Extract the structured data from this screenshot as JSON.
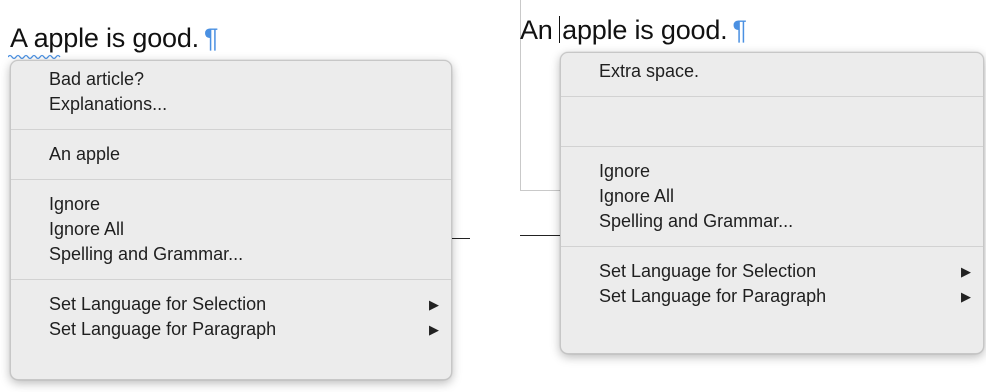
{
  "left": {
    "sentence": "A apple is good.",
    "pilcrow": "¶",
    "menu": {
      "suggestions": [
        "Bad article?",
        "Explanations..."
      ],
      "corrections": [
        "An apple"
      ],
      "actions": [
        "Ignore",
        "Ignore All",
        "Spelling and Grammar..."
      ],
      "language": [
        "Set Language for Selection",
        "Set Language for Paragraph"
      ]
    }
  },
  "right": {
    "sentence_before": "An",
    "sentence_after": "apple is good.",
    "pilcrow": "¶",
    "menu": {
      "suggestions": [
        "Extra space."
      ],
      "corrections": [
        ""
      ],
      "actions": [
        "Ignore",
        "Ignore All",
        "Spelling and Grammar..."
      ],
      "language": [
        "Set Language for Selection",
        "Set Language for Paragraph"
      ]
    }
  },
  "submenu_arrow": "▶",
  "colors": {
    "pilcrow": "#4a90e2",
    "squiggle": "#4a90e2",
    "menu_bg": "#ececec"
  }
}
